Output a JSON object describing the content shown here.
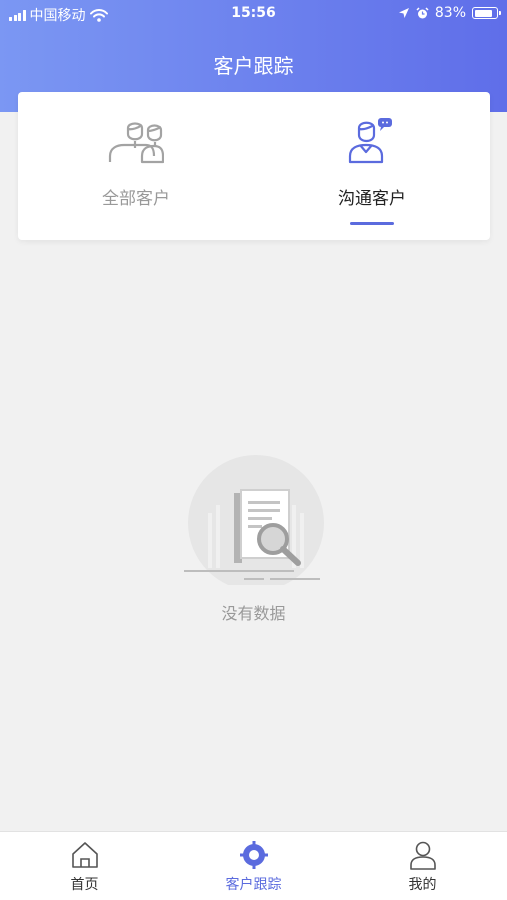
{
  "status_bar": {
    "carrier": "中国移动",
    "time": "15:56",
    "battery": "83%",
    "battery_level": 0.83
  },
  "header": {
    "title": "客户跟踪"
  },
  "tabs": [
    {
      "label": "全部客户",
      "icon": "users-icon",
      "active": false
    },
    {
      "label": "沟通客户",
      "icon": "user-chat-icon",
      "active": true
    }
  ],
  "empty_state": {
    "icon": "no-data-document-search-icon",
    "text": "没有数据"
  },
  "bottom_nav": [
    {
      "label": "首页",
      "icon": "home-icon",
      "active": false
    },
    {
      "label": "客户跟踪",
      "icon": "target-icon",
      "active": true
    },
    {
      "label": "我的",
      "icon": "person-icon",
      "active": false
    }
  ],
  "colors": {
    "accent": "#5b6bde",
    "header_start": "#7b97f3",
    "header_end": "#5f6ee9",
    "inactive_text": "#999999",
    "background": "#f1f1f1"
  }
}
